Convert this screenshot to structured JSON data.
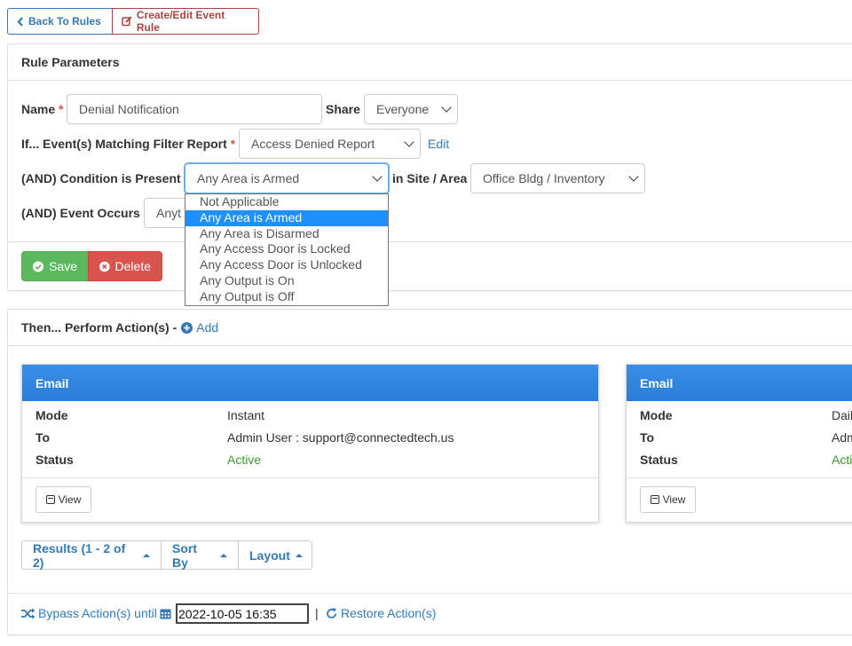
{
  "nav": {
    "back_label": "Back To Rules",
    "create_label": "Create/Edit Event Rule"
  },
  "params": {
    "title": "Rule Parameters",
    "name_label": "Name",
    "name_value": "Denial Notification",
    "share_label": "Share",
    "share_value": "Everyone",
    "filter_label": "If... Event(s) Matching Filter Report",
    "filter_value": "Access Denied Report",
    "edit_link": "Edit",
    "condition_label": "(AND) Condition is Present",
    "condition_value": "Any Area is Armed",
    "condition_options": [
      "Not Applicable",
      "Any Area is Armed",
      "Any Area is Disarmed",
      "Any Access Door is Locked",
      "Any Access Door is Unlocked",
      "Any Output is On",
      "Any Output is Off"
    ],
    "condition_selected_index": 1,
    "site_label": "in Site / Area",
    "site_value": "Office Bldg / Inventory",
    "event_occurs_label": "(AND) Event Occurs",
    "event_occurs_value": "Anyt",
    "required_mark": "*",
    "save_label": "Save",
    "delete_label": "Delete"
  },
  "actions": {
    "title": "Then... Perform Action(s) -",
    "add_label": "Add",
    "cards": [
      {
        "title": "Email",
        "mode_label": "Mode",
        "mode_value": "Instant",
        "to_label": "To",
        "to_value": "Admin User : support@connectedtech.us",
        "status_label": "Status",
        "status_value": "Active",
        "view_label": "View"
      },
      {
        "title": "Email",
        "mode_label": "Mode",
        "mode_value": "Dail",
        "to_label": "To",
        "to_value": "Adm",
        "status_label": "Status",
        "status_value": "Acti",
        "view_label": "View"
      }
    ],
    "results_label": "Results (1 - 2 of 2)",
    "sortby_label": "Sort By",
    "layout_label": "Layout",
    "bypass_label": "Bypass Action(s) until",
    "bypass_date": "2022-10-05 16:35",
    "separator": "|",
    "restore_label": "Restore Action(s)"
  },
  "colors": {
    "primary": "#337ab7",
    "danger": "#d9534f",
    "success": "#5cb85c",
    "card_header": "#2a7dd8",
    "active_status": "#3c9a2c"
  }
}
